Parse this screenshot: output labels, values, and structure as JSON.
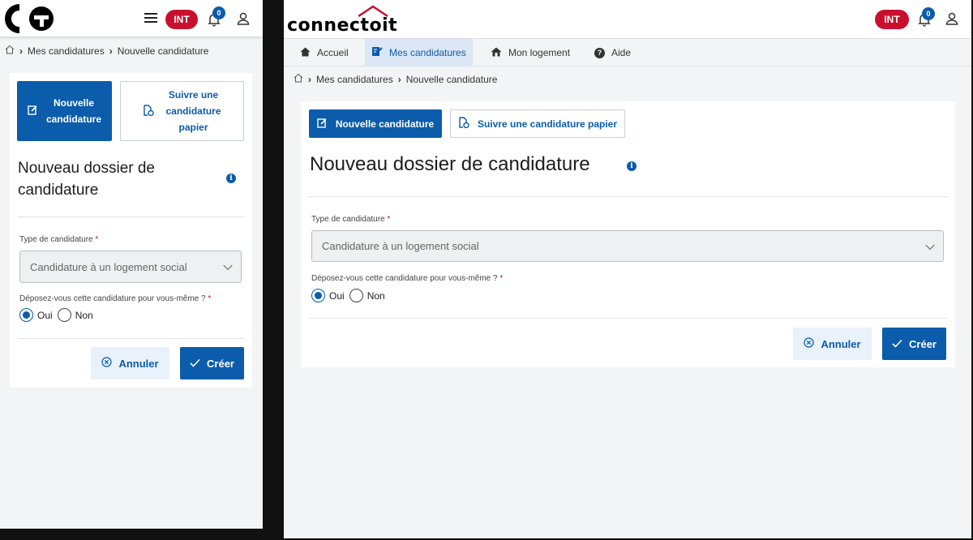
{
  "env_badge": "INT",
  "notifications_count": "0",
  "logo_text": "connectoit",
  "nav": [
    {
      "label": "Accueil",
      "icon": "home-icon"
    },
    {
      "label": "Mes candidatures",
      "icon": "edit-doc-icon"
    },
    {
      "label": "Mon logement",
      "icon": "house-icon"
    },
    {
      "label": "Aide",
      "icon": "help-icon"
    }
  ],
  "breadcrumb": {
    "item1": "Mes candidatures",
    "item2": "Nouvelle candidature"
  },
  "actions": {
    "new_label": "Nouvelle candidature",
    "new_line1": "Nouvelle",
    "new_line2": "candidature",
    "follow_label": "Suivre une candidature papier",
    "follow_line1": "Suivre une",
    "follow_line2": "candidature",
    "follow_line3": "papier"
  },
  "title": "Nouveau dossier de candidature",
  "title_line1": "Nouveau dossier de",
  "title_line2": "candidature",
  "form": {
    "type_label": "Type de candidature",
    "type_value": "Candidature à un logement social",
    "self_label": "Déposez-vous cette candidature pour vous-même ?",
    "required_mark": "*",
    "opt_yes": "Oui",
    "opt_no": "Non"
  },
  "buttons": {
    "cancel": "Annuler",
    "create": "Créer"
  },
  "colors": {
    "primary": "#0b5cab",
    "accent": "#c8102e"
  }
}
